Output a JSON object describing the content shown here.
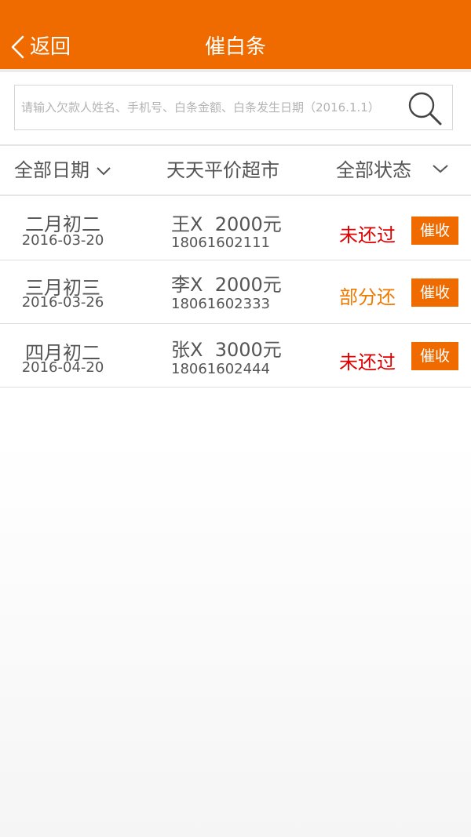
{
  "header": {
    "back_label": "返回",
    "title": "催白条"
  },
  "search": {
    "placeholder": "请输入欠款人姓名、手机号、白条金额、白条发生日期（2016.1.1）"
  },
  "filters": {
    "date": "全部日期",
    "store": "天天平价超市",
    "status": "全部状态"
  },
  "records": [
    {
      "lunar_date": "二月初二",
      "date": "2016-03-20",
      "name": "王X",
      "amount": "2000元",
      "phone": "18061602111",
      "status": "未还过",
      "action": "催收"
    },
    {
      "lunar_date": "三月初三",
      "date": "2016-03-26",
      "name": "李X",
      "amount": "2000元",
      "phone": "18061602333",
      "status": "部分还",
      "action": "催收"
    },
    {
      "lunar_date": "四月初二",
      "date": "2016-04-20",
      "name": "张X",
      "amount": "3000元",
      "phone": "18061602444",
      "status": "未还过",
      "action": "催收"
    }
  ],
  "colors": {
    "brand": "#ef6b00",
    "status_unpaid": "#e00000",
    "status_partial": "#ef7a00"
  },
  "icons": {
    "back": "chevron-left-icon",
    "search": "search-icon",
    "dropdown": "chevron-down-icon"
  }
}
